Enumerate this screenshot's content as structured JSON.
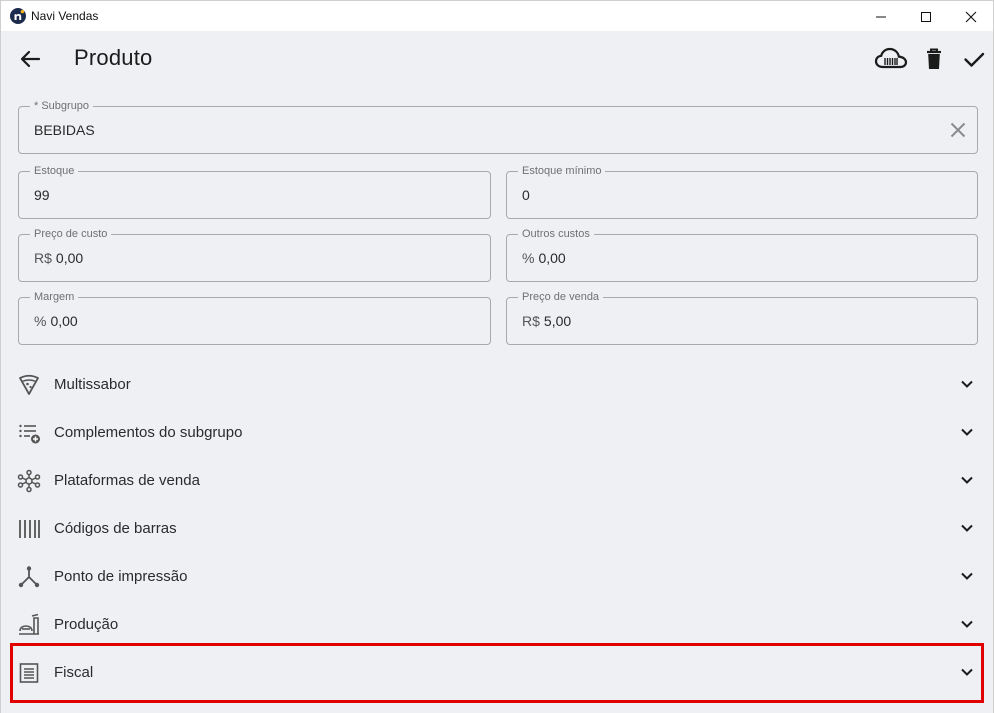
{
  "window": {
    "title": "Navi Vendas"
  },
  "header": {
    "title": "Produto"
  },
  "fields": {
    "subgrupo": {
      "label": "* Subgrupo",
      "value": "BEBIDAS"
    },
    "estoque": {
      "label": "Estoque",
      "value": "99"
    },
    "estoque_minimo": {
      "label": "Estoque mínimo",
      "value": "0"
    },
    "preco_custo": {
      "label": "Preço de custo",
      "prefix": "R$",
      "value": "0,00"
    },
    "outros_custos": {
      "label": "Outros custos",
      "prefix": "%",
      "value": "0,00"
    },
    "margem": {
      "label": "Margem",
      "prefix": "%",
      "value": "0,00"
    },
    "preco_venda": {
      "label": "Preço de venda",
      "prefix": "R$",
      "value": "5,00"
    }
  },
  "sections": [
    {
      "label": "Multissabor",
      "icon": "pizza-slice-icon"
    },
    {
      "label": "Complementos do subgrupo",
      "icon": "list-add-icon"
    },
    {
      "label": "Plataformas de venda",
      "icon": "network-hub-icon"
    },
    {
      "label": "Códigos de barras",
      "icon": "barcode-icon"
    },
    {
      "label": "Ponto de impressão",
      "icon": "branch-icon"
    },
    {
      "label": "Produção",
      "icon": "kitchen-icon"
    },
    {
      "label": "Fiscal",
      "icon": "receipt-icon"
    }
  ],
  "colors": {
    "background": "#eff0f4",
    "highlight": "#e00000",
    "text": "#2b2b2b"
  }
}
